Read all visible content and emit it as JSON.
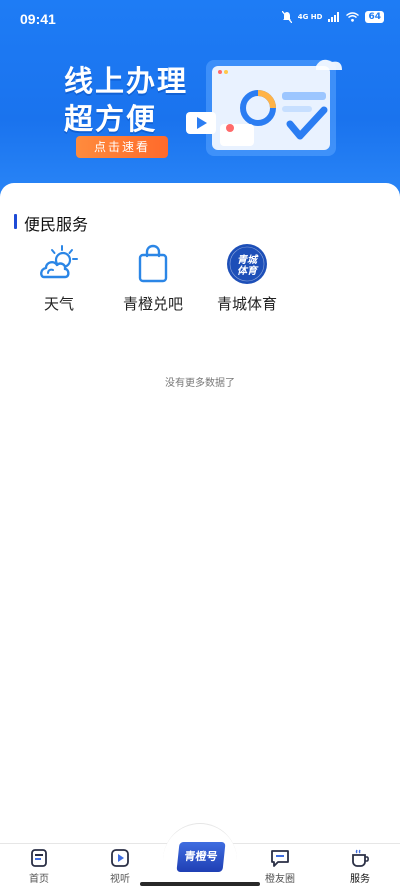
{
  "status_bar": {
    "time": "09:41",
    "network": "4G HD",
    "battery": "64"
  },
  "banner": {
    "title_line1": "线上办理",
    "title_line2": "超方便",
    "cta": "点击速看"
  },
  "section": {
    "title": "便民服务"
  },
  "services": [
    {
      "label": "天气",
      "icon": "weather-icon"
    },
    {
      "label": "青橙兑吧",
      "icon": "shopping-bag-icon"
    },
    {
      "label": "青城体育",
      "icon": "qingcheng-sports-logo",
      "logo_text": "青城体育"
    }
  ],
  "empty_state": {
    "text": "没有更多数据了"
  },
  "tabbar": {
    "items": [
      {
        "label": "首页",
        "icon": "home-icon"
      },
      {
        "label": "视听",
        "icon": "play-icon"
      },
      {
        "label": "青橙号",
        "icon": "qingcheng-logo"
      },
      {
        "label": "橙友圈",
        "icon": "chat-icon"
      },
      {
        "label": "服务",
        "icon": "service-cup-icon"
      }
    ],
    "active": "服务"
  },
  "colors": {
    "primary_blue": "#1a73ee",
    "accent_orange": "#ff6a2b",
    "icon_blue": "#2b86e6",
    "text_dark": "#222222"
  }
}
